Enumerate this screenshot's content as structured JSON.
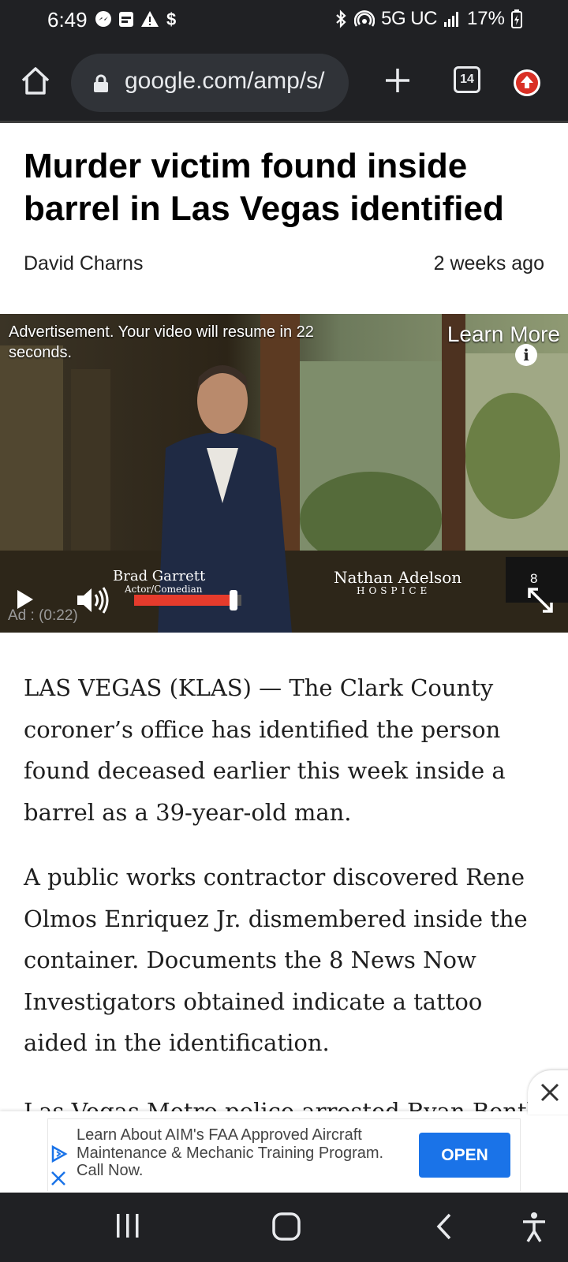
{
  "status_bar": {
    "time": "6:49",
    "network": "5G UC",
    "battery": "17%"
  },
  "browser": {
    "url": "google.com/amp/s/",
    "tab_count": "14"
  },
  "article": {
    "headline": "Murder victim found inside barrel in Las Vegas identified",
    "author": "David Charns",
    "timestamp": "2 weeks ago",
    "paragraphs": [
      "LAS VEGAS (KLAS) — The Clark County coroner’s office has identified the person found deceased earlier this week inside a barrel as a 39-year-old man.",
      "A public works contractor discovered Rene Olmos Enriquez Jr. dismembered inside the container. Documents the 8 News Now Investigators obtained indicate a tattoo aided in the identification.",
      "Las Vegas Metro police arrested Ryan Bentley"
    ]
  },
  "video_ad": {
    "notice": "Advertisement. Your video will resume in 22 seconds.",
    "learn_more": "Learn More",
    "person_name": "Brad Garrett",
    "person_role": "Actor/Comedian",
    "sponsor_name": "Nathan Adelson",
    "sponsor_sub": "HOSPICE",
    "timer": "Ad : (0:22)",
    "skip_count": "8",
    "progress": 0.93,
    "progress_color": "#e53b2c"
  },
  "bottom_ad": {
    "text": "Learn About AIM's FAA Approved Aircraft Maintenance & Mechanic Training Program. Call Now.",
    "cta": "OPEN",
    "cta_color": "#1a73e8"
  },
  "icons": {
    "status": [
      "messenger-icon",
      "calendar-icon",
      "warning-icon",
      "dollar-icon",
      "bluetooth-icon",
      "hotspot-icon",
      "signal-icon",
      "battery-charging-icon"
    ],
    "toolbar": [
      "home-icon",
      "lock-icon",
      "plus-icon",
      "tabs-icon",
      "update-icon"
    ],
    "nav": [
      "recents-icon",
      "home-circle-icon",
      "back-icon",
      "accessibility-icon"
    ]
  }
}
